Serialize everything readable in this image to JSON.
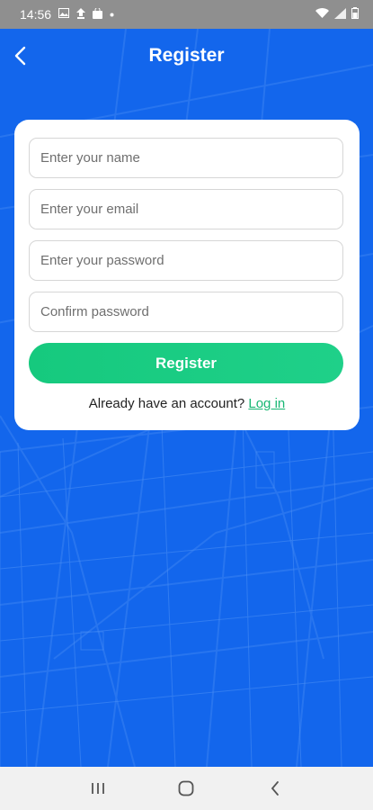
{
  "status_bar": {
    "time": "14:56",
    "left_icons": [
      "image-icon",
      "upload-icon",
      "bag-icon",
      "dot-icon"
    ],
    "right_icons": [
      "wifi-icon",
      "signal-icon",
      "battery-icon"
    ]
  },
  "header": {
    "title": "Register",
    "back_icon": "chevron-left-icon"
  },
  "form": {
    "name_placeholder": "Enter your name",
    "email_placeholder": "Enter your email",
    "password_placeholder": "Enter your password",
    "confirm_placeholder": "Confirm password",
    "submit_label": "Register",
    "login_prompt": "Already have an account?",
    "login_link": "Log in"
  },
  "nav": {
    "icons": [
      "recent-apps-icon",
      "home-icon",
      "back-icon"
    ]
  },
  "colors": {
    "background": "#1366ec",
    "primary_button": "#1bcc84",
    "link": "#18b774",
    "card": "#ffffff"
  }
}
